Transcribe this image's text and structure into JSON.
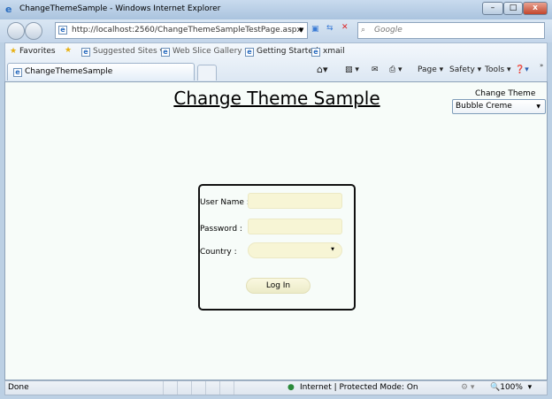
{
  "window": {
    "title": "ChangeThemeSample - Windows Internet Explorer"
  },
  "address": {
    "url": "http://localhost:2560/ChangeThemeSampleTestPage.aspx",
    "search_placeholder": "Google"
  },
  "favorites": {
    "favorites_label": "Favorites",
    "items": [
      "Suggested Sites ▾",
      "Web Slice Gallery ▾",
      "Getting Started",
      "xmail"
    ]
  },
  "tab": {
    "label": "ChangeThemeSample"
  },
  "commands": {
    "page": "Page ▾",
    "safety": "Safety ▾",
    "tools": "Tools ▾"
  },
  "page": {
    "title": "Change Theme Sample",
    "theme_label": "Change Theme",
    "theme_value": "Bubble Creme"
  },
  "login": {
    "username_label": "User Name :",
    "password_label": "Password :",
    "country_label": "Country :",
    "login_button": "Log In"
  },
  "status": {
    "text": "Done",
    "zone": "Internet | Protected Mode: On",
    "zoom": "100%"
  }
}
